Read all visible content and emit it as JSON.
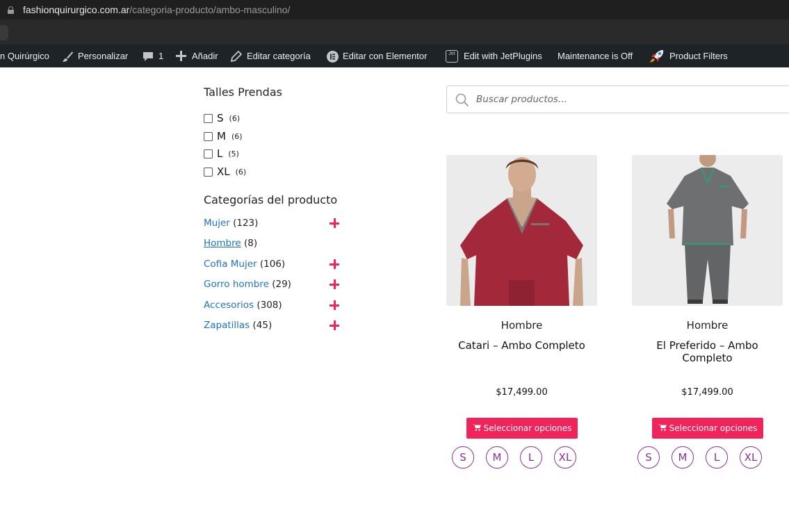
{
  "browser": {
    "url_domain": "fashionquirurgico.com.ar",
    "url_path": "/categoria-producto/ambo-masculino/"
  },
  "admin_bar": {
    "site_name": "n Quirúrgico",
    "customize": "Personalizar",
    "comments_count": "1",
    "add_new": "Añadir",
    "edit_category": "Editar categoría",
    "edit_elementor": "Editar con Elementor",
    "jet_icon_text": "Jet",
    "edit_jetplugins": "Edit with JetPlugins",
    "maintenance": "Maintenance is Off",
    "product_filters": "Product Filters"
  },
  "sidebar": {
    "sizes_title": "Talles Prendas",
    "sizes": [
      {
        "label": "S",
        "count": "(6)"
      },
      {
        "label": "M",
        "count": "(6)"
      },
      {
        "label": "L",
        "count": "(5)"
      },
      {
        "label": "XL",
        "count": "(6)"
      }
    ],
    "categories_title": "Categorías del producto",
    "categories": [
      {
        "label": "Mujer",
        "count": "(123)",
        "expandable": true
      },
      {
        "label": "Hombre",
        "count": "(8)",
        "expandable": false
      },
      {
        "label": "Cofia Mujer",
        "count": "(106)",
        "expandable": true
      },
      {
        "label": "Gorro hombre",
        "count": "(29)",
        "expandable": true
      },
      {
        "label": "Accesorios",
        "count": "(308)",
        "expandable": true
      },
      {
        "label": "Zapatillas",
        "count": "(45)",
        "expandable": true
      }
    ]
  },
  "search": {
    "placeholder": "Buscar productos..."
  },
  "products": [
    {
      "category": "Hombre",
      "title": "Catari – Ambo Completo",
      "price": "$17,499.00",
      "button": "Seleccionar opciones",
      "sizes": [
        "S",
        "M",
        "L",
        "XL"
      ],
      "shirt_color": "#a3283a"
    },
    {
      "category": "Hombre",
      "title": "El Preferido – Ambo Completo",
      "price": "$17,499.00",
      "button": "Seleccionar opciones",
      "sizes": [
        "S",
        "M",
        "L",
        "XL"
      ],
      "shirt_color": "#6d6f70"
    }
  ],
  "colors": {
    "accent": "#f0245a",
    "link": "#1e73be",
    "swatch": "#8b2f9b",
    "admin_bar": "#1d2327"
  }
}
